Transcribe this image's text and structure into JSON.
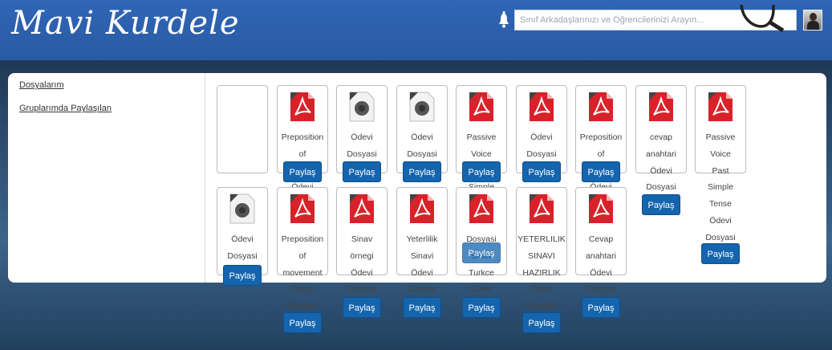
{
  "header": {
    "logo": "Mavi Kurdele",
    "search_placeholder": "Sınıf Arkadaşlarınızı ve Öğrencilerinizi Arayın...",
    "brand_color": "#2f66b7"
  },
  "sidebar": {
    "items": [
      {
        "label": "Dosyalarım"
      },
      {
        "label": "Gruplarımda Paylaşılan"
      }
    ]
  },
  "share_label": "Paylaş",
  "files": [
    {
      "label": "",
      "icon": "none"
    },
    {
      "label": "Preposition\nof\nmovement\nÖdevi",
      "icon": "pdf-icon"
    },
    {
      "label": "Ödevi\nDosyasi",
      "icon": "generic-file-icon"
    },
    {
      "label": "Ödevi\nDosyasi",
      "icon": "generic-file-icon"
    },
    {
      "label": "Passive\nVoice\nPresent\nSimple",
      "icon": "pdf-icon"
    },
    {
      "label": "Ödevi\nDosyasi",
      "icon": "pdf-icon"
    },
    {
      "label": "Preposition\nof\nmovement\nÖdevi",
      "icon": "pdf-icon"
    },
    {
      "label": "cevap\nanahtari\nÖdevi\nDosyasi",
      "icon": "pdf-icon"
    },
    {
      "label": "Passive\nVoice\nPast\nSimple\nTense\nÖdevi\nDosyasi",
      "icon": "pdf-icon"
    },
    {
      "label": "Ödevi\nDosyasi",
      "icon": "generic-file-icon"
    },
    {
      "label": "Preposition\nof\nmovement\nÖdevi\nDosyasi",
      "icon": "pdf-icon"
    },
    {
      "label": "Sinav\nörnegi\nÖdevi\nDosyasi",
      "icon": "pdf-icon"
    },
    {
      "label": "Yeterlilik\nSinavi\nÖdevi\nDosyasi",
      "icon": "pdf-icon"
    },
    {
      "label": "Dosyasi\nSinav\nTurkce\nÖdevi\nDosyasi",
      "icon": "pdf-icon"
    },
    {
      "label": "YETERLILIK\nSINAVI\nHAZIRLIK\nÖdevi\nDosyasi",
      "icon": "pdf-icon"
    },
    {
      "label": "Cevap\nanahtari\nÖdevi\nDosyasi",
      "icon": "pdf-icon"
    }
  ]
}
